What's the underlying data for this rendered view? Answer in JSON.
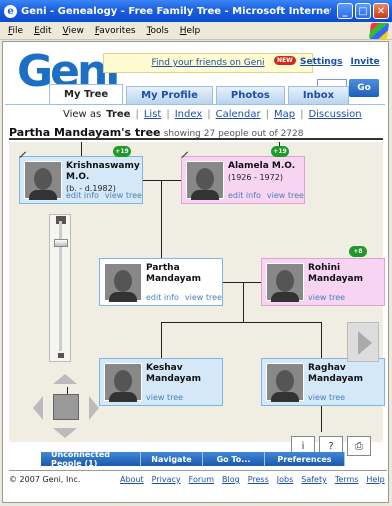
{
  "window": {
    "title": "Geni - Genealogy - Free Family Tree - Microsoft Internet Explorer"
  },
  "menu": [
    "File",
    "Edit",
    "View",
    "Favorites",
    "Tools",
    "Help"
  ],
  "header": {
    "logo": "Geni",
    "find_friends": "Find your friends on Geni",
    "new_badge": "NEW",
    "links": [
      "Settings",
      "Invite"
    ],
    "search_placeholder": "",
    "go_label": "Go"
  },
  "tabs": [
    {
      "label": "My Tree",
      "active": true
    },
    {
      "label": "My Profile",
      "active": false
    },
    {
      "label": "Photos",
      "active": false
    },
    {
      "label": "Inbox",
      "active": false
    }
  ],
  "view_as": {
    "prefix": "View as",
    "current": "Tree",
    "options": [
      "List",
      "Index",
      "Calendar",
      "Map",
      "Discussion"
    ]
  },
  "tree": {
    "title": "Partha Mandayam's tree",
    "count_text": "showing 27 people out of 2728"
  },
  "people": [
    {
      "name_line1": "Krishnaswamy",
      "name_line2": "M.O.",
      "dates": "(b. - d.1982)",
      "links": [
        "edit info",
        "view tree"
      ],
      "badge": "+19"
    },
    {
      "name_line1": "Alamela M.O.",
      "name_line2": "",
      "dates": "(1926 - 1972)",
      "links": [
        "edit info",
        "view tree"
      ],
      "badge": "+19"
    },
    {
      "name_line1": "Partha",
      "name_line2": "Mandayam",
      "dates": "",
      "links": [
        "edit info",
        "view tree"
      ],
      "badge": ""
    },
    {
      "name_line1": "Rohini Mandayam",
      "name_line2": "",
      "dates": "",
      "links": [
        "view tree"
      ],
      "badge": "+8"
    },
    {
      "name_line1": "Keshav",
      "name_line2": "Mandayam",
      "dates": "",
      "links": [
        "view tree"
      ],
      "badge": ""
    },
    {
      "name_line1": "Raghav",
      "name_line2": "Mandayam",
      "dates": "",
      "links": [
        "view tree"
      ],
      "badge": ""
    }
  ],
  "bottom_tabs": [
    "Unconnected People (1)",
    "Navigate",
    "Go To...",
    "Preferences"
  ],
  "footer": {
    "copyright": "© 2007 Geni, Inc.",
    "links": [
      "About",
      "Privacy",
      "Forum",
      "Blog",
      "Press",
      "Jobs",
      "Safety",
      "Terms",
      "Help"
    ]
  },
  "colors": {
    "male_card": "#d4e8f8",
    "female_card": "#f7d4f2",
    "badge_green": "#1d9a28",
    "brand_blue": "#1d6fc4"
  }
}
